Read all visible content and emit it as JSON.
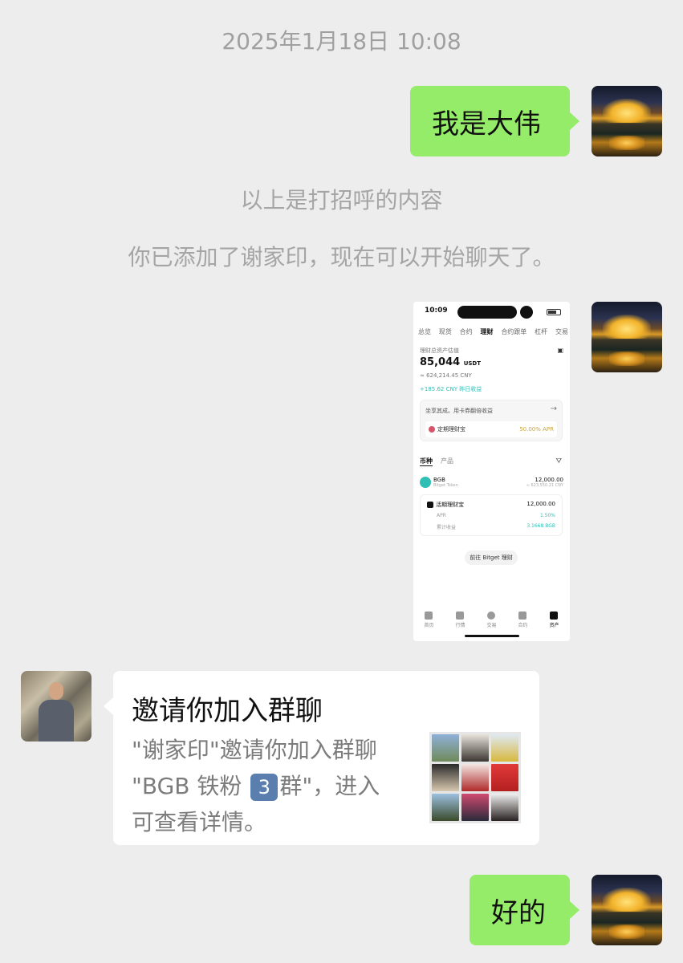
{
  "timestamp": "2025年1月18日 10:08",
  "messages": {
    "greeting_text": "我是大伟",
    "system_notice_1": "以上是打招呼的内容",
    "system_notice_2": "你已添加了谢家印，现在可以开始聊天了。",
    "reply_text": "好的"
  },
  "screenshot": {
    "time": "10:09",
    "tabs": [
      "总览",
      "现货",
      "合约",
      "理财",
      "合约跟单",
      "杠杆",
      "交易"
    ],
    "active_tab": "理财",
    "assets_label": "理财总资产估值",
    "assets_value": "85,044",
    "assets_unit": "USDT",
    "assets_cny": "≈ 624,214.45 CNY",
    "yesterday": "+185.62 CNY 昨日收益",
    "promo_title": "坐享其成。用卡券翻倍收益",
    "promo_product": "定期理财宝",
    "promo_apr": "50.00% APR",
    "section_tabs": [
      "币种",
      "产品"
    ],
    "coin_name": "BGB",
    "coin_sub": "Bitget Token",
    "coin_amount": "12,000.00",
    "coin_cny": "≈ 623,550.21 CNY",
    "product_name": "活期理财宝",
    "product_amount": "12,000.00",
    "apr_label": "APR",
    "apr_value": "1.50%",
    "earned_label": "累计收益",
    "earned_value": "3.1668 BGB",
    "goto_button": "前往 Bitget 理财",
    "nav": [
      "首页",
      "行情",
      "交易",
      "合约",
      "资产"
    ],
    "active_nav": "资产"
  },
  "invite_card": {
    "title": "邀请你加入群聊",
    "line1": "\"谢家印\"邀请你加入群聊",
    "line2_prefix": "\"BGB 铁粉 ",
    "badge": "3",
    "line2_suffix": "群\"，进入",
    "line3": "可查看详情。"
  },
  "colors": {
    "chat_background": "#ededed",
    "self_bubble": "#95ec69",
    "other_bubble": "#ffffff",
    "accent_teal": "#2fbfb5"
  }
}
